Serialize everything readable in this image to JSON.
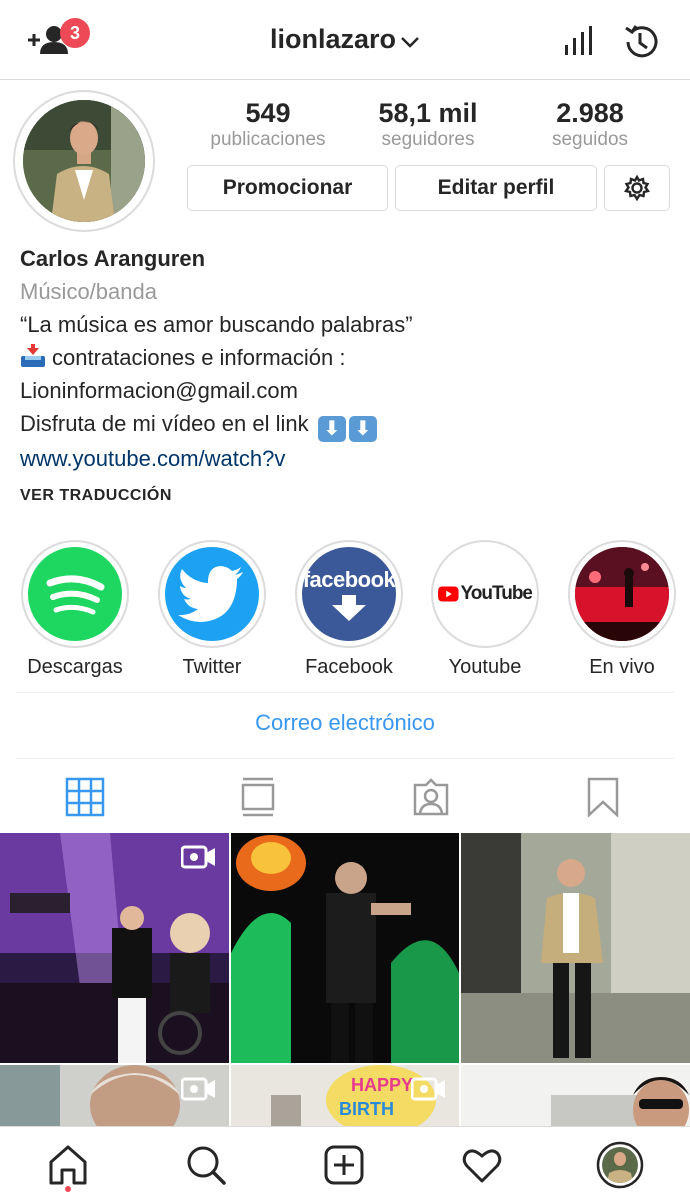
{
  "header": {
    "username": "lionlazaro",
    "notification_count": "3",
    "icons": [
      "add-user-icon",
      "chevron-down-icon",
      "insights-icon",
      "history-icon"
    ]
  },
  "profile": {
    "stats": [
      {
        "value": "549",
        "label": "publicaciones"
      },
      {
        "value": "58,1 mil",
        "label": "seguidores"
      },
      {
        "value": "2.988",
        "label": "seguidos"
      }
    ],
    "buttons": {
      "promote": "Promocionar",
      "edit": "Editar perfil"
    },
    "name": "Carlos Aranguren",
    "category": "Músico/banda",
    "bio_lines": [
      "“La música es amor buscando palabras”",
      "contrataciones e información :",
      "Lioninformacion@gmail.com",
      "Disfruta de mi vídeo en el link"
    ],
    "website": "www.youtube.com/watch?v",
    "translate_label": "VER TRADUCCIÓN",
    "contact_label": "Correo electrónico"
  },
  "highlights": [
    {
      "label": "Descargas",
      "icon": "spotify-icon"
    },
    {
      "label": "Twitter",
      "icon": "twitter-icon"
    },
    {
      "label": "Facebook",
      "icon": "facebook-icon",
      "logo_text": "facebook"
    },
    {
      "label": "Youtube",
      "icon": "youtube-icon",
      "logo_text": "YouTube"
    },
    {
      "label": "En vivo",
      "icon": "concert-photo"
    }
  ],
  "tabs": [
    "grid-icon",
    "feed-icon",
    "tagged-icon",
    "saved-icon"
  ],
  "bottom_nav": [
    "home-icon",
    "search-icon",
    "add-post-icon",
    "heart-icon",
    "profile-avatar"
  ],
  "colors": {
    "accent_blue": "#3897f0",
    "link_blue": "#003569",
    "badge_red": "#ed4956",
    "spotify_green": "#1ed760",
    "twitter_blue": "#1da1f2",
    "facebook_blue": "#3b5998",
    "youtube_red": "#ff0000"
  }
}
